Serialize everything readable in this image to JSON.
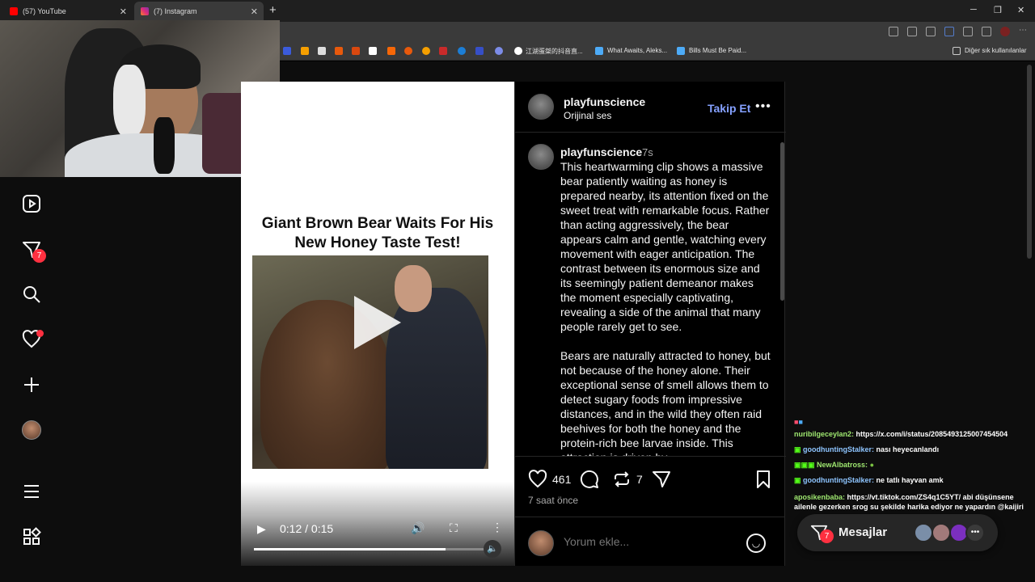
{
  "browser": {
    "tabs": [
      {
        "label": "(57) YouTube",
        "favicon_color": "#ff0000"
      },
      {
        "label": "(7) Instagram",
        "favicon_color": "#dd2a7b"
      }
    ],
    "bookmarks": [
      {
        "label": "江湖蛋桀的抖音直...",
        "icon": "tiktok-icon"
      },
      {
        "label": "What Awaits, Aleks...",
        "icon": "verified-icon"
      },
      {
        "label": "Bills Must Be Paid...",
        "icon": "verified-icon"
      }
    ],
    "other_bookmarks": "Diğer sık kullanılanlar"
  },
  "sidebar": {
    "reels_icon": "reels-icon",
    "messages_badge": "7",
    "icons": [
      "reels-icon",
      "messages-icon",
      "search-icon",
      "heart-icon",
      "create-icon",
      "profile-icon",
      "menu-icon",
      "more-icon"
    ]
  },
  "post": {
    "media_title": "Giant Brown Bear Waits For His New Honey Taste Test!",
    "video_time": "0:12 / 0:15",
    "video_progress": 0.8,
    "header_username": "playfunscience",
    "header_audio": "Orijinal ses",
    "follow_label": "Takip Et",
    "caption_username": "playfunscience",
    "caption_time": "7s",
    "caption_text": "This heartwarming clip shows a massive bear patiently waiting as honey is prepared nearby, its attention fixed on the sweet treat with remarkable focus. Rather than acting aggressively, the bear appears calm and gentle, watching every movement with eager anticipation. The contrast between its enormous size and its seemingly patient demeanor makes the moment especially captivating, revealing a side of the animal that many people rarely get to see.\n\nBears are naturally attracted to honey, but not because of the honey alone. Their exceptional sense of smell allows them to detect sugary foods from impressive distances, and in the wild they often raid beehives for both the honey and the protein-rich bee larvae inside. This attraction is driven by",
    "likes": "461",
    "reposts": "7",
    "time_ago": "7 saat önce",
    "comment_placeholder": "Yorum ekle..."
  },
  "chat": [
    {
      "name": "nuribilgeceylan2:",
      "text": "https://x.com/i/status/2085493125007454504"
    },
    {
      "name": "goodhuntingStalker:",
      "text": "nası heyecanlandı"
    },
    {
      "name": "NewAlbatross:",
      "text": ""
    },
    {
      "name": "goodhuntingStalker:",
      "text": "ne tatlı hayvan amk"
    },
    {
      "name": "aposikenbaba:",
      "text": "https://vt.tiktok.com/ZS4q1C5YT/ abi düşünsene ailenle gezerken srog su şekilde harika  ediyor ne yapardın @kaijiri"
    }
  ],
  "dm": {
    "label": "Mesajlar",
    "badge": "7"
  }
}
